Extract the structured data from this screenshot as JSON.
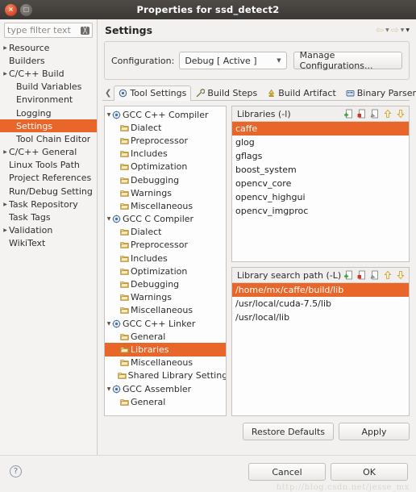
{
  "window": {
    "title": "Properties for ssd_detect2",
    "close_label": "×",
    "maximize_label": "□"
  },
  "filter": {
    "placeholder": "type filter text",
    "clear_icon": "clear-icon",
    "value": ""
  },
  "sidebar": {
    "items": [
      {
        "label": "Resource",
        "expandable": true,
        "indent": 0,
        "selected": false
      },
      {
        "label": "Builders",
        "expandable": false,
        "indent": 0,
        "selected": false
      },
      {
        "label": "C/C++ Build",
        "expandable": true,
        "indent": 0,
        "selected": false
      },
      {
        "label": "Build Variables",
        "expandable": false,
        "indent": 1,
        "selected": false
      },
      {
        "label": "Environment",
        "expandable": false,
        "indent": 1,
        "selected": false
      },
      {
        "label": "Logging",
        "expandable": false,
        "indent": 1,
        "selected": false
      },
      {
        "label": "Settings",
        "expandable": false,
        "indent": 1,
        "selected": true
      },
      {
        "label": "Tool Chain Editor",
        "expandable": false,
        "indent": 1,
        "selected": false
      },
      {
        "label": "C/C++ General",
        "expandable": true,
        "indent": 0,
        "selected": false
      },
      {
        "label": "Linux Tools Path",
        "expandable": false,
        "indent": 0,
        "selected": false
      },
      {
        "label": "Project References",
        "expandable": false,
        "indent": 0,
        "selected": false
      },
      {
        "label": "Run/Debug Setting",
        "expandable": false,
        "indent": 0,
        "selected": false
      },
      {
        "label": "Task Repository",
        "expandable": true,
        "indent": 0,
        "selected": false
      },
      {
        "label": "Task Tags",
        "expandable": false,
        "indent": 0,
        "selected": false
      },
      {
        "label": "Validation",
        "expandable": true,
        "indent": 0,
        "selected": false
      },
      {
        "label": "WikiText",
        "expandable": false,
        "indent": 0,
        "selected": false
      }
    ]
  },
  "page": {
    "title": "Settings",
    "nav": {
      "back_icon": "arrow-left-icon",
      "back_menu_icon": "chevron-down-icon",
      "forward_icon": "arrow-right-icon",
      "forward_menu_icon": "chevron-down-icon",
      "view_menu_icon": "chevron-down-icon"
    }
  },
  "configuration": {
    "label": "Configuration:",
    "selected": "Debug  [ Active ]",
    "dropdown_icon": "chevron-down-icon",
    "manage_button": "Manage Configurations..."
  },
  "tabs": {
    "scroll_left_icon": "chevron-left-icon",
    "scroll_right_icon": "chevron-right-icon",
    "items": [
      {
        "label": "Tool Settings",
        "icon": "tool-settings-icon",
        "active": true
      },
      {
        "label": "Build Steps",
        "icon": "wrench-icon",
        "active": false
      },
      {
        "label": "Build Artifact",
        "icon": "artifact-icon",
        "active": false
      },
      {
        "label": "Binary Parsers",
        "icon": "binary-parser-icon",
        "active": false
      }
    ]
  },
  "tool_tree": {
    "items": [
      {
        "label": "GCC C++ Compiler",
        "icon": "gear-icon",
        "child": false,
        "expandable": true,
        "selected": false
      },
      {
        "label": "Dialect",
        "icon": "folder-icon",
        "child": true,
        "expandable": false,
        "selected": false
      },
      {
        "label": "Preprocessor",
        "icon": "folder-icon",
        "child": true,
        "expandable": false,
        "selected": false
      },
      {
        "label": "Includes",
        "icon": "folder-icon",
        "child": true,
        "expandable": false,
        "selected": false
      },
      {
        "label": "Optimization",
        "icon": "folder-icon",
        "child": true,
        "expandable": false,
        "selected": false
      },
      {
        "label": "Debugging",
        "icon": "folder-icon",
        "child": true,
        "expandable": false,
        "selected": false
      },
      {
        "label": "Warnings",
        "icon": "folder-icon",
        "child": true,
        "expandable": false,
        "selected": false
      },
      {
        "label": "Miscellaneous",
        "icon": "folder-icon",
        "child": true,
        "expandable": false,
        "selected": false
      },
      {
        "label": "GCC C Compiler",
        "icon": "gear-icon",
        "child": false,
        "expandable": true,
        "selected": false
      },
      {
        "label": "Dialect",
        "icon": "folder-icon",
        "child": true,
        "expandable": false,
        "selected": false
      },
      {
        "label": "Preprocessor",
        "icon": "folder-icon",
        "child": true,
        "expandable": false,
        "selected": false
      },
      {
        "label": "Includes",
        "icon": "folder-icon",
        "child": true,
        "expandable": false,
        "selected": false
      },
      {
        "label": "Optimization",
        "icon": "folder-icon",
        "child": true,
        "expandable": false,
        "selected": false
      },
      {
        "label": "Debugging",
        "icon": "folder-icon",
        "child": true,
        "expandable": false,
        "selected": false
      },
      {
        "label": "Warnings",
        "icon": "folder-icon",
        "child": true,
        "expandable": false,
        "selected": false
      },
      {
        "label": "Miscellaneous",
        "icon": "folder-icon",
        "child": true,
        "expandable": false,
        "selected": false
      },
      {
        "label": "GCC C++ Linker",
        "icon": "gear-icon",
        "child": false,
        "expandable": true,
        "selected": false
      },
      {
        "label": "General",
        "icon": "folder-icon",
        "child": true,
        "expandable": false,
        "selected": false
      },
      {
        "label": "Libraries",
        "icon": "folder-icon",
        "child": true,
        "expandable": false,
        "selected": true
      },
      {
        "label": "Miscellaneous",
        "icon": "folder-icon",
        "child": true,
        "expandable": false,
        "selected": false
      },
      {
        "label": "Shared Library Settings",
        "icon": "folder-icon",
        "child": true,
        "expandable": false,
        "selected": false
      },
      {
        "label": "GCC Assembler",
        "icon": "gear-icon",
        "child": false,
        "expandable": true,
        "selected": false
      },
      {
        "label": "General",
        "icon": "folder-icon",
        "child": true,
        "expandable": false,
        "selected": false
      }
    ]
  },
  "libraries_panel": {
    "title": "Libraries (-l)",
    "tools": [
      {
        "name": "add-icon",
        "title": "Add"
      },
      {
        "name": "delete-icon",
        "title": "Delete"
      },
      {
        "name": "edit-icon",
        "title": "Edit"
      },
      {
        "name": "move-up-icon",
        "title": "Move Up"
      },
      {
        "name": "move-down-icon",
        "title": "Move Down"
      }
    ],
    "rows": [
      {
        "value": "caffe",
        "selected": true
      },
      {
        "value": "glog",
        "selected": false
      },
      {
        "value": "gflags",
        "selected": false
      },
      {
        "value": "boost_system",
        "selected": false
      },
      {
        "value": "opencv_core",
        "selected": false
      },
      {
        "value": "opencv_highgui",
        "selected": false
      },
      {
        "value": "opencv_imgproc",
        "selected": false
      }
    ]
  },
  "search_path_panel": {
    "title": "Library search path (-L)",
    "tools": [
      {
        "name": "add-icon",
        "title": "Add"
      },
      {
        "name": "delete-icon",
        "title": "Delete"
      },
      {
        "name": "edit-icon",
        "title": "Edit"
      },
      {
        "name": "move-up-icon",
        "title": "Move Up"
      },
      {
        "name": "move-down-icon",
        "title": "Move Down"
      }
    ],
    "rows": [
      {
        "value": "/home/mx/caffe/build/lib",
        "selected": true
      },
      {
        "value": "/usr/local/cuda-7.5/lib",
        "selected": false
      },
      {
        "value": "/usr/local/lib",
        "selected": false
      }
    ]
  },
  "actions": {
    "restore_defaults": "Restore Defaults",
    "apply": "Apply",
    "cancel": "Cancel",
    "ok": "OK",
    "help_icon": "help-icon",
    "help_glyph": "?"
  },
  "watermark": "http://blog.csdn.net/jesse_mx",
  "colors": {
    "selection": "#e8662a",
    "titlebar": "#3c3835",
    "panel_bg": "#f2f1f0",
    "list_bg": "#fdfdfd"
  }
}
